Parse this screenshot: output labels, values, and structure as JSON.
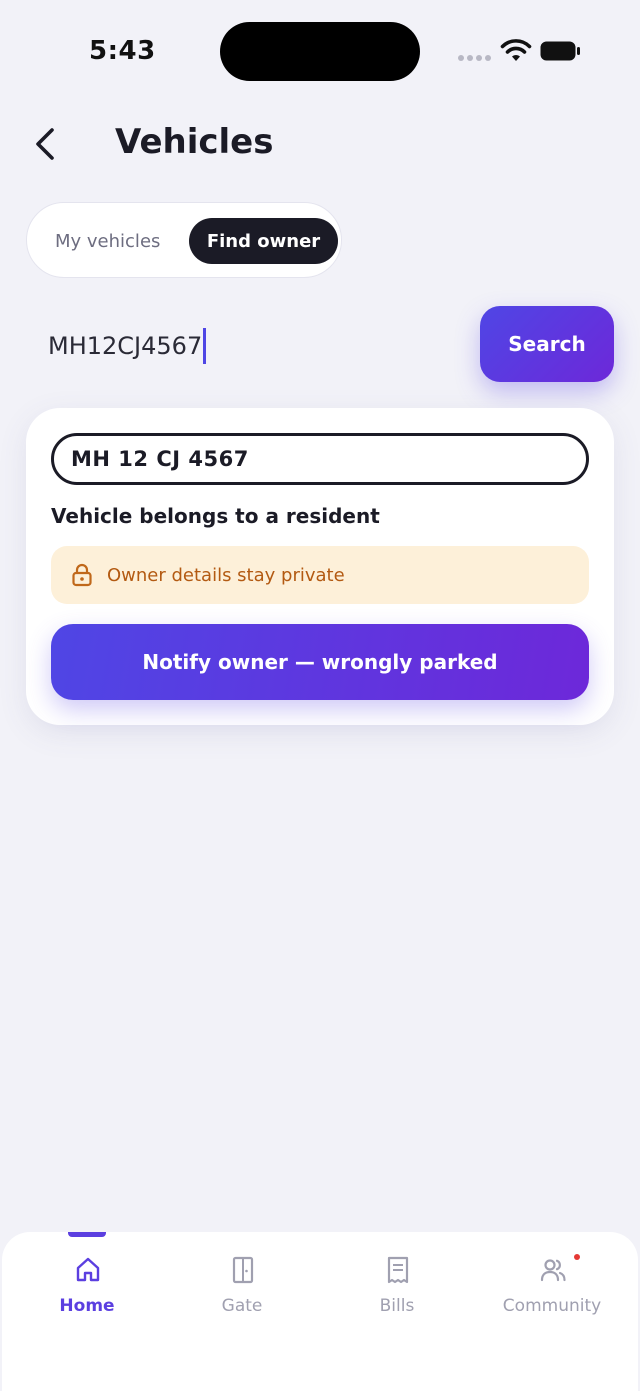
{
  "status_bar": {
    "time": "5:43"
  },
  "header": {
    "title": "Vehicles"
  },
  "tabs": [
    {
      "label": "My vehicles",
      "active": false
    },
    {
      "label": "Find owner",
      "active": true
    }
  ],
  "search": {
    "value": "MH12CJ4567",
    "button_label": "Search"
  },
  "result": {
    "plate": "MH 12 CJ 4567",
    "status": "Vehicle belongs to a resident",
    "privacy_note": "Owner details stay private",
    "action_label": "Notify owner — wrongly parked"
  },
  "nav": {
    "items": [
      {
        "label": "Home",
        "icon": "home-icon",
        "active": true
      },
      {
        "label": "Gate",
        "icon": "door-icon",
        "active": false
      },
      {
        "label": "Bills",
        "icon": "receipt-icon",
        "active": false
      },
      {
        "label": "Community",
        "icon": "people-icon",
        "active": false,
        "badge": true
      }
    ]
  },
  "colors": {
    "accent": "#5b3fe0",
    "dark": "#1b1b26",
    "warning_bg": "#fdf0d9",
    "warning_text": "#b35a12",
    "background": "#f2f2f8"
  }
}
